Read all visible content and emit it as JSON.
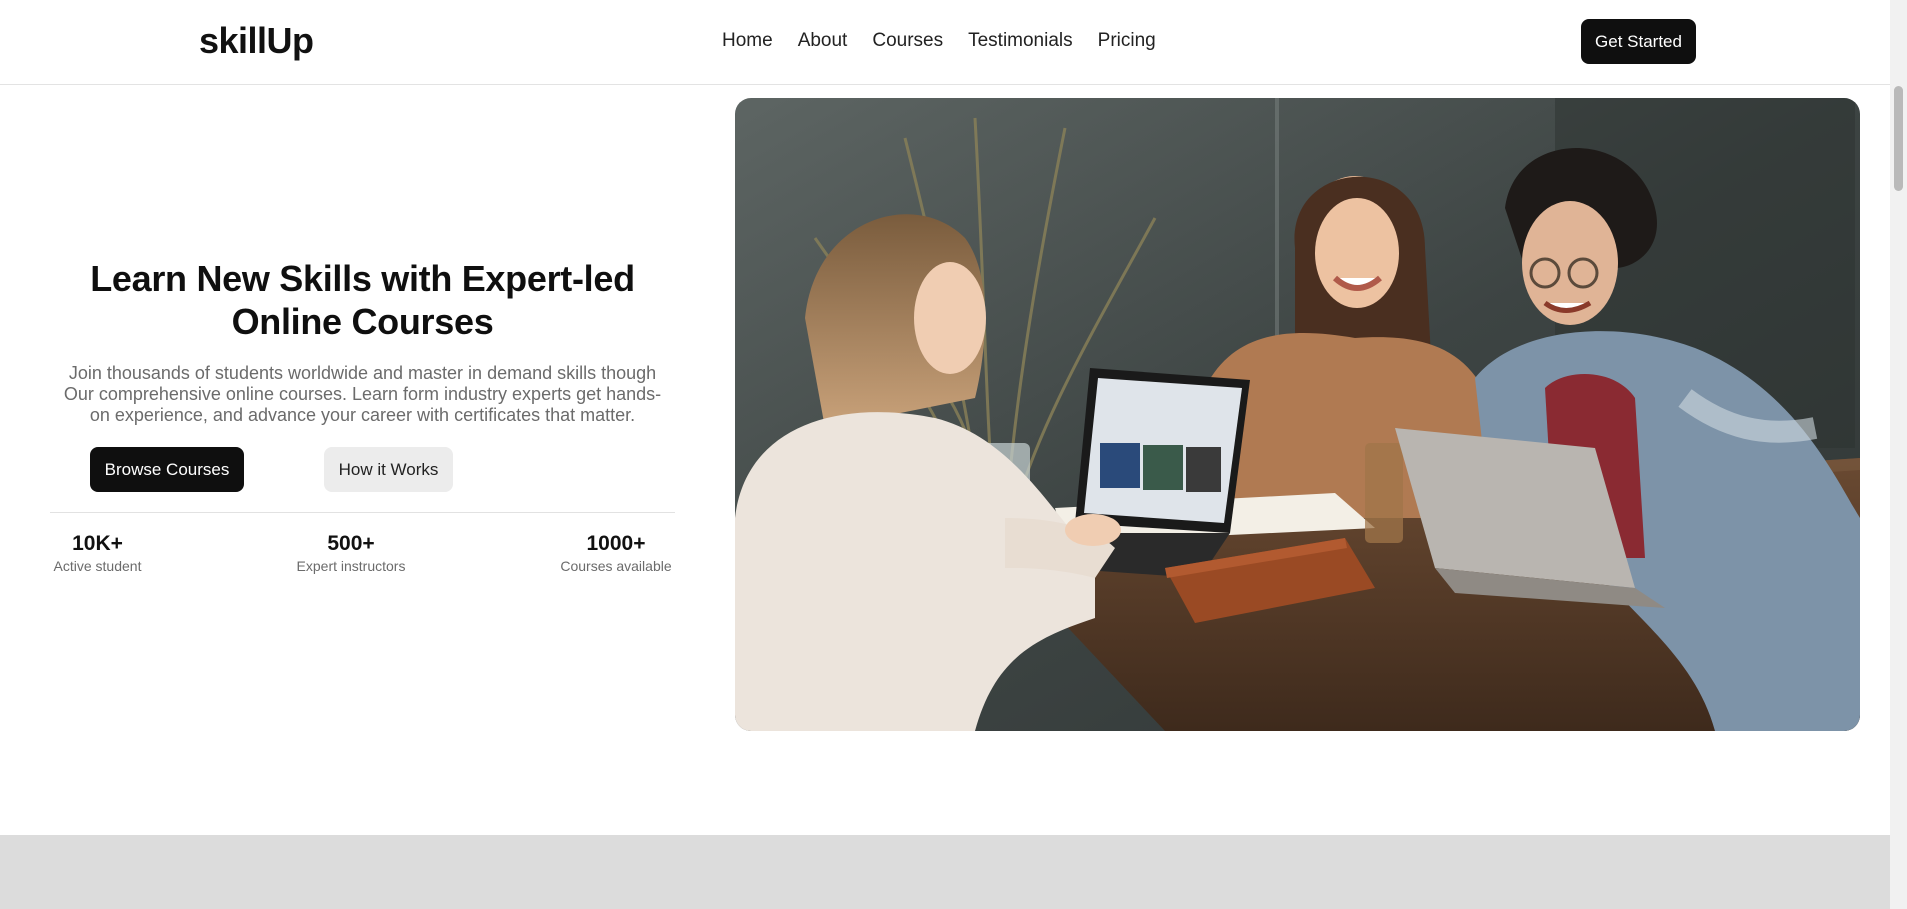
{
  "brand": {
    "name": "skillUp"
  },
  "nav": {
    "items": [
      {
        "label": "Home"
      },
      {
        "label": "About"
      },
      {
        "label": "Courses"
      },
      {
        "label": "Testimonials"
      },
      {
        "label": "Pricing"
      }
    ],
    "cta_label": "Get Started"
  },
  "hero": {
    "title_line1": "Learn New Skills with Expert-led",
    "title_line2": "Online Courses",
    "desc_line1": "Join thousands of students worldwide and master in demand skills though",
    "desc_line2": "Our comprehensive online courses. Learn form industry experts get hands-",
    "desc_line3": "on experience, and advance your career with certificates that matter.",
    "primary_button": "Browse Courses",
    "secondary_button": "How it Works",
    "stats": [
      {
        "value": "10K+",
        "label": "Active student"
      },
      {
        "value": "500+",
        "label": "Expert instructors"
      },
      {
        "value": "1000+",
        "label": "Courses available"
      }
    ],
    "image_alt": "Three students laughing around a table with laptops"
  },
  "colors": {
    "primary": "#0f0f0f",
    "secondary_bg": "#ececec",
    "muted_text": "#6b6b6b",
    "band": "#dcdcdc"
  }
}
